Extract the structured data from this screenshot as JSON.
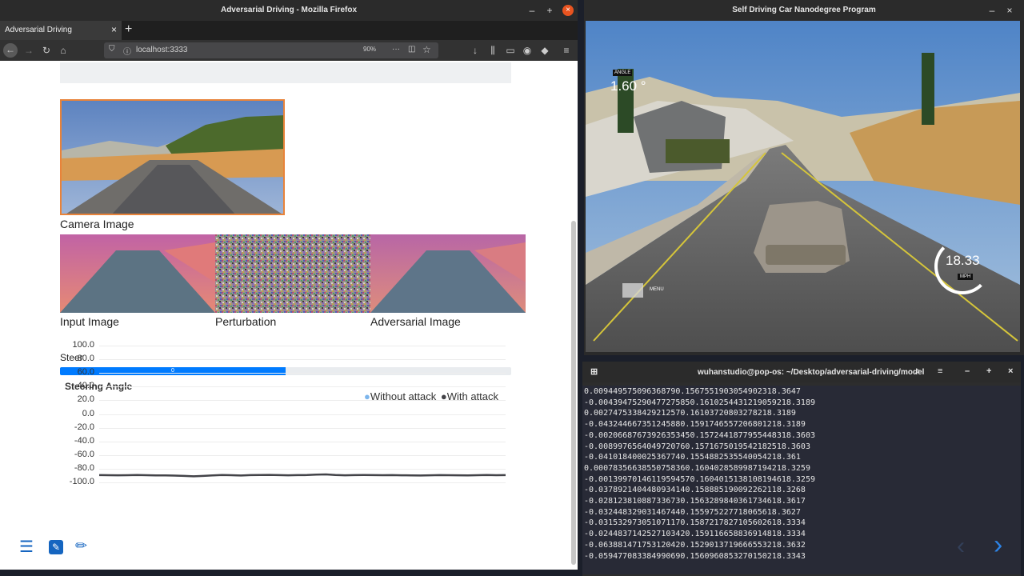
{
  "firefox": {
    "window_title": "Adversarial Driving - Mozilla Firefox",
    "tab_label": "Adversarial Driving",
    "url": "localhost:3333",
    "zoom": "90%"
  },
  "page": {
    "camera_caption": "Camera Image",
    "input_caption": "Input Image",
    "perturbation_caption": "Perturbation",
    "adversarial_caption": "Adversarial Image",
    "steer_label": "Steer",
    "steer_value": "0",
    "steer_fraction": 0.5
  },
  "chart_data": {
    "type": "line",
    "title": "Steering Angle",
    "ylim": [
      -100,
      100
    ],
    "yticks": [
      "100.0",
      "80.0",
      "60.0",
      "40.0",
      "20.0",
      "0.0",
      "-20.0",
      "-40.0",
      "-60.0",
      "-80.0",
      "-100.0"
    ],
    "series": [
      {
        "name": "Without attack",
        "color": "#7cb5ec",
        "values": [
          -0.5,
          -0.6,
          -0.7,
          -0.6,
          -0.4,
          -0.6,
          -0.8,
          -0.9,
          -1.2,
          -1.6,
          -2.2,
          -1.6,
          -0.9,
          -0.4,
          -0.6,
          -1.0,
          -0.5,
          -0.2,
          -0.1,
          -0.5,
          -0.7,
          -0.5,
          -0.3,
          0.3,
          0.6,
          -0.3,
          -0.7,
          -0.5,
          -0.4,
          -0.5,
          -0.6,
          -0.5,
          -0.7,
          -0.8,
          -1.0,
          -0.7,
          -0.5,
          -0.6,
          -0.7,
          -0.9,
          -0.6,
          -0.4,
          -0.6,
          -0.5
        ]
      },
      {
        "name": "With attack",
        "color": "#434348",
        "values": [
          -0.5,
          -0.6,
          -0.7,
          -0.6,
          -0.4,
          -0.6,
          -0.8,
          -0.9,
          -1.2,
          -1.6,
          -2.2,
          -1.6,
          -0.9,
          -0.4,
          -0.6,
          -1.0,
          -0.5,
          -0.2,
          -0.1,
          -0.5,
          -0.7,
          -0.5,
          -0.3,
          0.3,
          0.6,
          -0.3,
          -0.7,
          -0.5,
          -0.4,
          -0.5,
          -0.6,
          -0.5,
          -0.7,
          -0.8,
          -1.0,
          -0.7,
          -0.5,
          -0.6,
          -0.7,
          -0.9,
          -0.6,
          -0.4,
          -0.6,
          -0.5
        ]
      }
    ],
    "grid": true,
    "legend_placement": "top-right"
  },
  "sim": {
    "window_title": "Self Driving Car Nanodegree Program",
    "angle_label": "ANGLE",
    "angle_value": "1.60 °",
    "speed_value": "18.33",
    "speed_unit": "MPH",
    "mode_label": "MENU"
  },
  "terminal": {
    "title": "wuhanstudio@pop-os: ~/Desktop/adversarial-driving/model",
    "lines": [
      "0.009449575096368 79 0.156755190305490 23 18.3647",
      "-0.004394752904772 7585 0.161025443121905 92 18.3189",
      "0.002747533842921 257 0.161037208032782 18.3189",
      "-0.043244667351245 88 0.159174655720680 12 18.3189",
      "-0.002066876739263 5345 0.157244187795544 83 18.3603",
      "-0.008997656404972 076 0.157167501954218 25 18.3603",
      "-0.041018400025367 74 0.155488253554005 42 18.361",
      "0.000783566385507 5836 0.160402858998719 42 18.3259",
      "-0.001399701461195 9457 0.160401513810819 46 18.3259",
      "-0.037892140448093 414 0.158885190092262 1 18.3268",
      "-0.028123810887336 73 0.156328984036173 46 18.3617",
      "-0.032448329031467 44 0.155975227718065 6 18.3627",
      "-0.031532973051071 17 0.158721782710560 26 18.3334",
      "-0.024483714252710 342 0.159116658836914 8 18.3334",
      "-0.063881471753120 42 0.152901371966655 32 18.3632",
      "-0.059477083384990 69 0.156096085327015 02 18.3343"
    ]
  },
  "dock": {
    "prev_icon": "chevron-left-icon",
    "next_icon": "chevron-right-icon"
  }
}
